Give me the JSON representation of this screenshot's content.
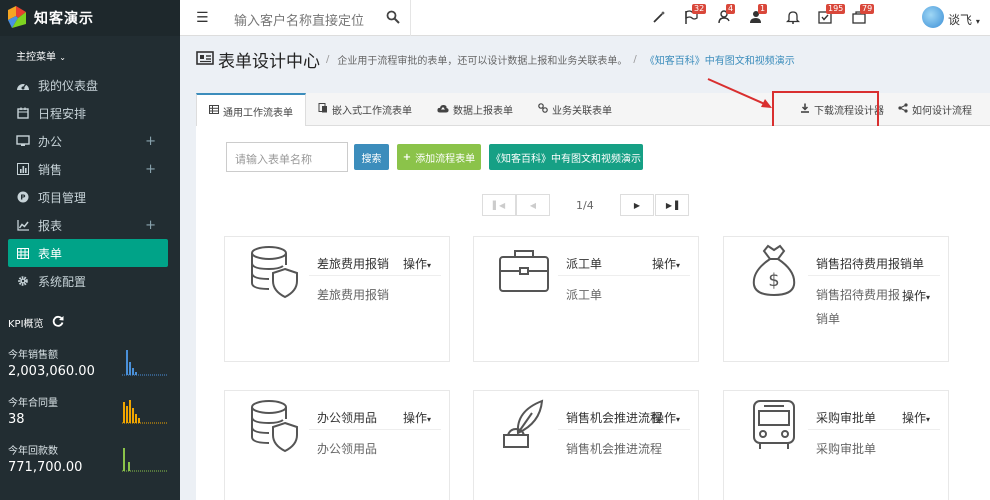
{
  "app": {
    "logo_text": "知客演示"
  },
  "sidebar": {
    "menu_header": "主控菜单",
    "items": [
      {
        "label": "我的仪表盘",
        "icon": "dashboard-icon",
        "expand": ""
      },
      {
        "label": "日程安排",
        "icon": "calendar-icon",
        "expand": ""
      },
      {
        "label": "办公",
        "icon": "desktop-icon",
        "expand": "+"
      },
      {
        "label": "销售",
        "icon": "bar-chart-icon",
        "expand": "+"
      },
      {
        "label": "项目管理",
        "icon": "project-icon",
        "expand": ""
      },
      {
        "label": "报表",
        "icon": "line-chart-icon",
        "expand": "+"
      },
      {
        "label": "表单",
        "icon": "table-icon",
        "expand": ""
      },
      {
        "label": "系统配置",
        "icon": "gear-icon",
        "expand": ""
      }
    ],
    "kpi_header": "KPI概览",
    "kpis": [
      {
        "label": "今年销售额",
        "value": "2,003,060.00",
        "color": "#4a90d9"
      },
      {
        "label": "今年合同量",
        "value": "38",
        "color": "#f0a500"
      },
      {
        "label": "今年回款数",
        "value": "771,700.00",
        "color": "#8bc34a"
      }
    ]
  },
  "topbar": {
    "search_placeholder": "输入客户名称直接定位",
    "badges": {
      "flag": "32",
      "user_lock": "4",
      "user_x": "1",
      "check": "195",
      "bag": "79"
    },
    "username": "谈飞"
  },
  "page": {
    "title": "表单设计中心",
    "separator": "/",
    "subtitle": "企业用于流程审批的表单，还可以设计数据上报和业务关联表单。",
    "link": "《知客百科》中有图文和视频演示"
  },
  "tabs": [
    {
      "label": "通用工作流表单",
      "icon": "table-icon"
    },
    {
      "label": "嵌入式工作流表单",
      "icon": "embed-icon"
    },
    {
      "label": "数据上报表单",
      "icon": "cloud-upload-icon"
    },
    {
      "label": "业务关联表单",
      "icon": "link-icon"
    }
  ],
  "actions": {
    "download": "下载流程设计器",
    "howto": "如何设计流程"
  },
  "toolbar": {
    "name_placeholder": "请输入表单名称",
    "search": "搜索",
    "add": "添加流程表单",
    "wiki": "《知客百科》中有图文和视频演示"
  },
  "pager": {
    "page_text": "1/4"
  },
  "cards": [
    {
      "name": "差旅费用报销",
      "op": "操作",
      "desc": "差旅费用报销",
      "icon": "database-shield-icon"
    },
    {
      "name": "派工单",
      "op": "操作",
      "desc": "派工单",
      "icon": "briefcase-icon"
    },
    {
      "name": "销售招待费用报销单",
      "op": "操作",
      "desc": "销售招待费用报销单",
      "icon": "money-bag-icon"
    },
    {
      "name": "办公领用品",
      "op": "操作",
      "desc": "办公领用品",
      "icon": "database-shield-icon"
    },
    {
      "name": "销售机会推进流程",
      "op": "操作",
      "desc": "销售机会推进流程",
      "icon": "quill-icon"
    },
    {
      "name": "采购审批单",
      "op": "操作",
      "desc": "采购审批单",
      "icon": "bus-icon"
    }
  ],
  "colors": {
    "sidebar": "#222d32",
    "accent": "#00a388",
    "link": "#3c8dbc",
    "search_btn": "#3c8dbc",
    "add_btn": "#8bc34a",
    "wiki_btn": "#16a085",
    "highlight": "#d92f2f"
  }
}
